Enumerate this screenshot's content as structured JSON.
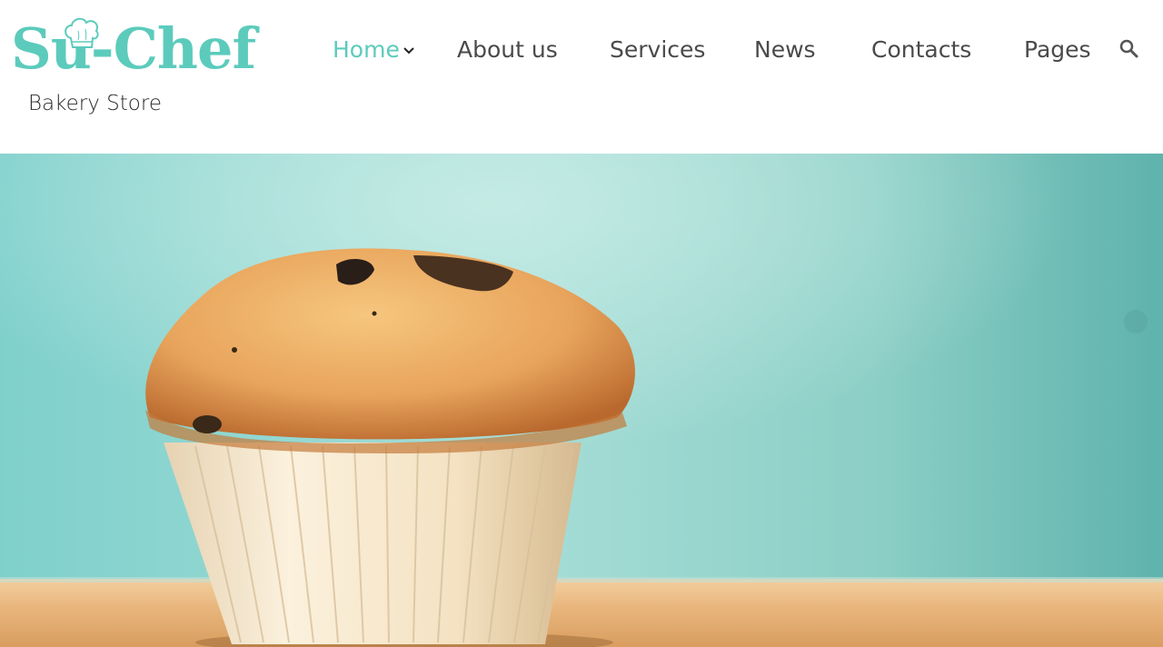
{
  "brand": {
    "name": "Su-Chef",
    "tagline": "Bakery Store",
    "accent_color": "#5ccbbc",
    "logo_icon": "chef-hat-icon"
  },
  "nav": {
    "items": [
      {
        "label": "Home",
        "active": true,
        "has_dropdown": true
      },
      {
        "label": "About us",
        "active": false
      },
      {
        "label": "Services",
        "active": false
      },
      {
        "label": "News",
        "active": false
      },
      {
        "label": "Contacts",
        "active": false
      },
      {
        "label": "Pages",
        "active": false
      }
    ],
    "text_color": "#4a4a4a",
    "search_icon": "search-icon"
  },
  "hero": {
    "subject": "muffin-photo"
  }
}
